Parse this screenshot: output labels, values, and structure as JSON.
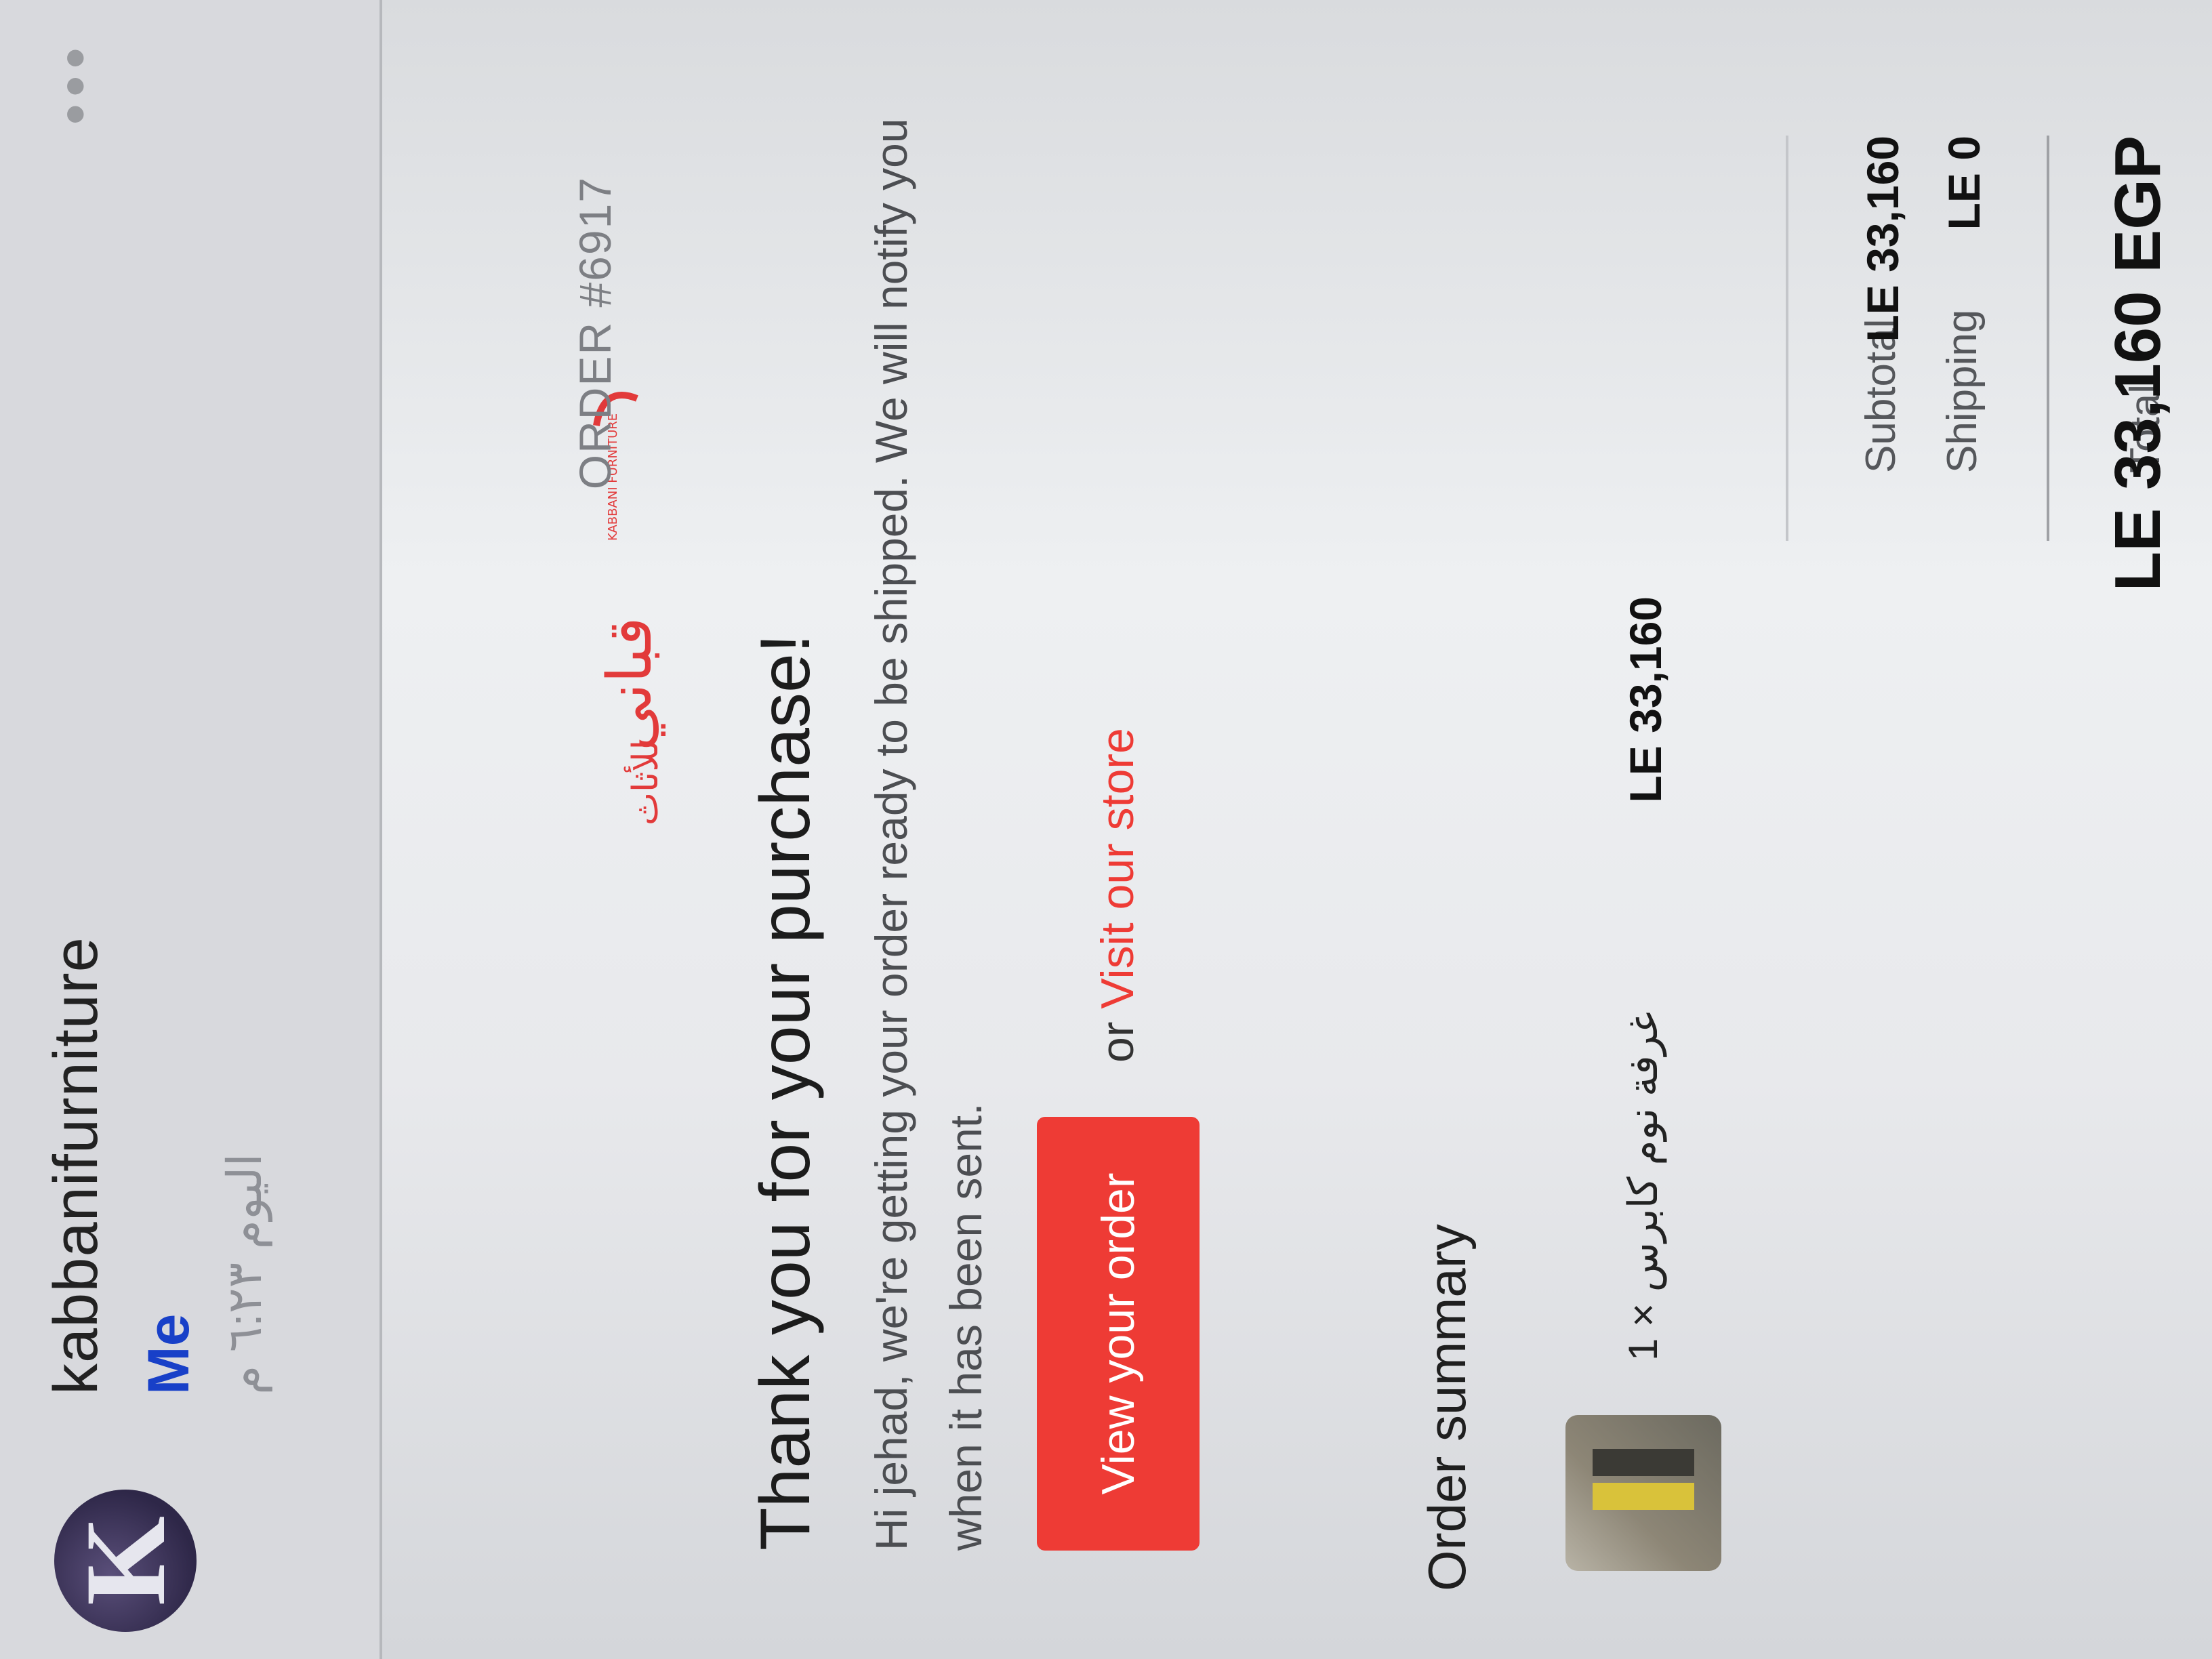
{
  "header": {
    "avatar_letter": "K",
    "sender": "kabbanifurniture",
    "recipient": "Me",
    "timestamp": "اليوم ٦:٢٣ م",
    "menu": "•••"
  },
  "email": {
    "brand_logo_text": "قباني",
    "brand_logo_sub": "للأثاث",
    "brand_logo_en": "KABBANI FURNITURE",
    "order_number": "ORDER #6917",
    "thanks_heading": "Thank you for your purchase!",
    "message": "Hi jehad, we're getting your order ready to be shipped. We will notify you when it has been sent.",
    "view_order_label": "View your order",
    "or_text": "or",
    "visit_store_label": "Visit our store",
    "summary_title": "Order summary",
    "item": {
      "name": "غرفة نوم كابرس × 1",
      "price": "LE 33,160"
    },
    "subtotal_label": "Subtotal",
    "subtotal_value": "LE 33,160",
    "shipping_label": "Shipping",
    "shipping_value": "LE 0",
    "total_label": "Total",
    "total_value": "LE 33,160 EGP"
  },
  "colors": {
    "accent": "#ee3b35",
    "recipient": "#1840c8"
  }
}
